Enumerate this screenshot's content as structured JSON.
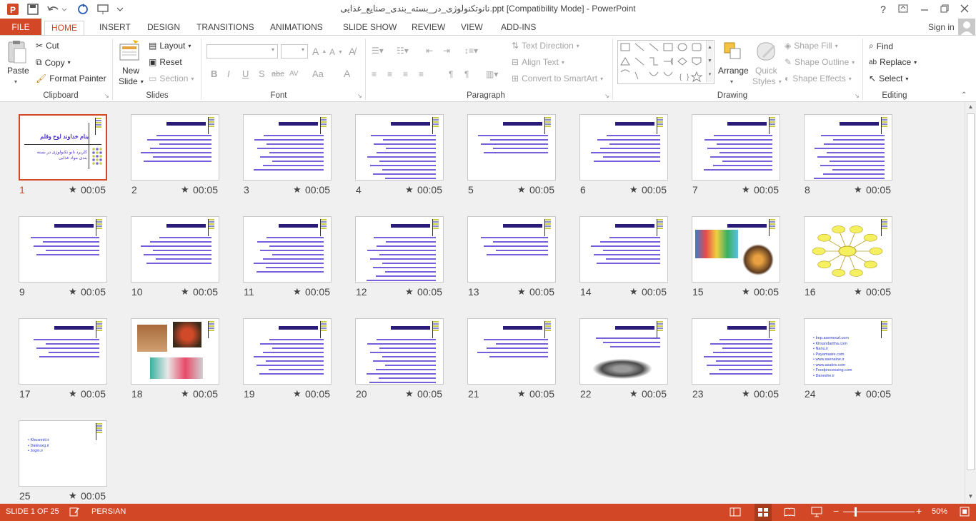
{
  "titlebar": {
    "title": "نانوتکنولوژی_در_بسته_بندی_صنایع_غذایی.ppt [Compatibility Mode] - PowerPoint",
    "help": "?"
  },
  "tabs": [
    "FILE",
    "HOME",
    "INSERT",
    "DESIGN",
    "TRANSITIONS",
    "ANIMATIONS",
    "SLIDE SHOW",
    "REVIEW",
    "VIEW",
    "ADD-INS"
  ],
  "account": {
    "sign_in": "Sign in"
  },
  "ribbon": {
    "clipboard": {
      "paste": "Paste",
      "cut": "Cut",
      "copy": "Copy",
      "format_painter": "Format Painter",
      "label": "Clipboard"
    },
    "slides": {
      "new_slide_1": "New",
      "new_slide_2": "Slide",
      "layout": "Layout",
      "reset": "Reset",
      "section": "Section",
      "label": "Slides"
    },
    "font": {
      "label": "Font",
      "bold": "B",
      "italic": "I",
      "underline": "U",
      "shadow": "S",
      "strike": "abc",
      "spacing": "AV",
      "case": "Aa",
      "color": "A"
    },
    "paragraph": {
      "text_direction": "Text Direction",
      "align_text": "Align Text",
      "convert_smartart": "Convert to SmartArt",
      "label": "Paragraph"
    },
    "drawing": {
      "arrange": "Arrange",
      "quick_styles_1": "Quick",
      "quick_styles_2": "Styles",
      "shape_fill": "Shape Fill",
      "shape_outline": "Shape Outline",
      "shape_effects": "Shape Effects",
      "label": "Drawing"
    },
    "editing": {
      "find": "Find",
      "replace": "Replace",
      "select": "Select",
      "label": "Editing"
    }
  },
  "slides": [
    {
      "num": "1",
      "time": "00:05",
      "kind": "title",
      "title_text": "بنام خداوند لوح وقلم",
      "sub_text": "کاربرد نانو تکنولوژی در بسته بندی مواد غذایی"
    },
    {
      "num": "2",
      "time": "00:05",
      "kind": "text"
    },
    {
      "num": "3",
      "time": "00:05",
      "kind": "text"
    },
    {
      "num": "4",
      "time": "00:05",
      "kind": "text"
    },
    {
      "num": "5",
      "time": "00:05",
      "kind": "text"
    },
    {
      "num": "6",
      "time": "00:05",
      "kind": "text"
    },
    {
      "num": "7",
      "time": "00:05",
      "kind": "text"
    },
    {
      "num": "8",
      "time": "00:05",
      "kind": "text"
    },
    {
      "num": "9",
      "time": "00:05",
      "kind": "text"
    },
    {
      "num": "10",
      "time": "00:05",
      "kind": "text"
    },
    {
      "num": "11",
      "time": "00:05",
      "kind": "text"
    },
    {
      "num": "12",
      "time": "00:05",
      "kind": "text"
    },
    {
      "num": "13",
      "time": "00:05",
      "kind": "text"
    },
    {
      "num": "14",
      "time": "00:05",
      "kind": "text"
    },
    {
      "num": "15",
      "time": "00:05",
      "kind": "photo"
    },
    {
      "num": "16",
      "time": "00:05",
      "kind": "diagram"
    },
    {
      "num": "17",
      "time": "00:05",
      "kind": "text"
    },
    {
      "num": "18",
      "time": "00:05",
      "kind": "photo2"
    },
    {
      "num": "19",
      "time": "00:05",
      "kind": "text"
    },
    {
      "num": "20",
      "time": "00:05",
      "kind": "text"
    },
    {
      "num": "21",
      "time": "00:05",
      "kind": "text"
    },
    {
      "num": "22",
      "time": "00:05",
      "kind": "photo3"
    },
    {
      "num": "23",
      "time": "00:05",
      "kind": "text"
    },
    {
      "num": "24",
      "time": "00:05",
      "kind": "links",
      "links": [
        "Irnp.asemoozl.com",
        "Khsandaritha.com",
        "Nanu.ir",
        "Payamaare.com",
        "www.asenaine.ir",
        "www.asabrs.com",
        "Foodprocessing.com",
        "Daneshe.ir"
      ]
    },
    {
      "num": "25",
      "time": "00:05",
      "kind": "links",
      "links": [
        "Khusnnit.ir",
        "Daknaxg.ir",
        "Jogin.ir"
      ]
    }
  ],
  "status": {
    "slide_info": "SLIDE 1 OF 25",
    "language": "PERSIAN",
    "zoom": "50%"
  },
  "colors": {
    "accent": "#d24726",
    "text_blue": "#4a2ad0"
  }
}
